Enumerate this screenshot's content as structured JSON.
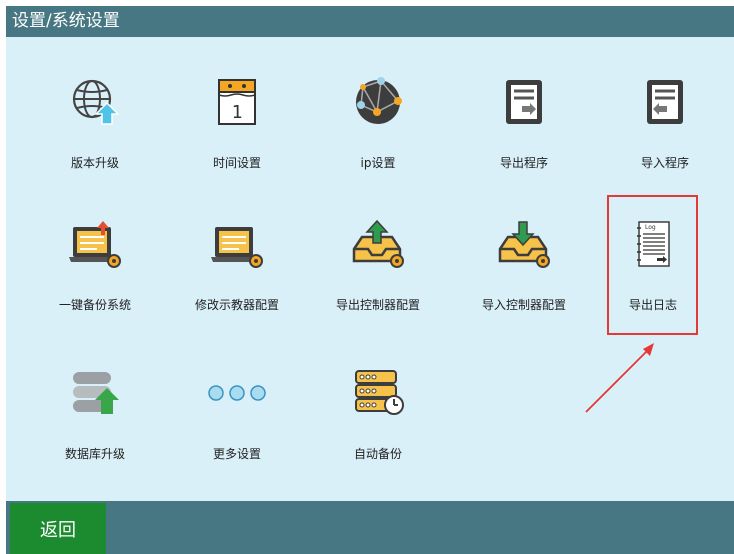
{
  "header": {
    "title": "设置/系统设置"
  },
  "tiles": [
    {
      "label": "版本升级",
      "icon": "globe-upgrade-icon"
    },
    {
      "label": "时间设置",
      "icon": "calendar-icon"
    },
    {
      "label": "ip设置",
      "icon": "network-sphere-icon"
    },
    {
      "label": "导出程序",
      "icon": "export-program-icon"
    },
    {
      "label": "导入程序",
      "icon": "import-program-icon"
    },
    {
      "label": "一键备份系统",
      "icon": "backup-system-icon"
    },
    {
      "label": "修改示教器配置",
      "icon": "teach-pendant-config-icon"
    },
    {
      "label": "导出控制器配置",
      "icon": "export-controller-config-icon"
    },
    {
      "label": "导入控制器配置",
      "icon": "import-controller-config-icon"
    },
    {
      "label": "导出日志",
      "icon": "export-log-icon"
    },
    {
      "label": "数据库升级",
      "icon": "database-upgrade-icon"
    },
    {
      "label": "更多设置",
      "icon": "more-dots-icon"
    },
    {
      "label": "自动备份",
      "icon": "auto-backup-icon"
    }
  ],
  "calendar": {
    "day": "1"
  },
  "log_icon": {
    "tag": "Log"
  },
  "footer": {
    "back_label": "返回"
  },
  "colors": {
    "title_bar": "#467782",
    "background": "#d9f0f8",
    "back_button": "#1c8a2e",
    "highlight": "#e53935"
  }
}
